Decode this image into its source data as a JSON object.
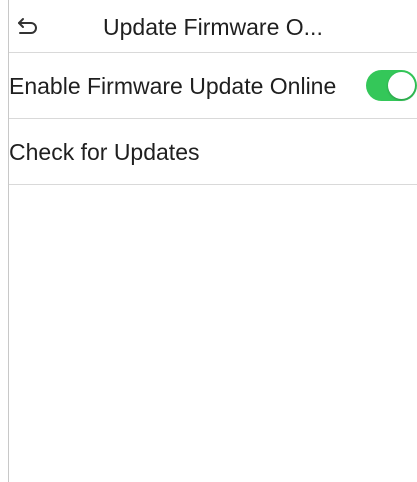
{
  "header": {
    "title": "Update Firmware O...",
    "back_icon": "back-arrow-icon"
  },
  "settings": [
    {
      "label": "Enable Firmware Update Online",
      "control": "toggle",
      "enabled": true
    },
    {
      "label": "Check for Updates"
    }
  ],
  "colors": {
    "toggle_on": "#34c759",
    "divider": "#d9d9d9",
    "text": "#1f1f1f"
  }
}
